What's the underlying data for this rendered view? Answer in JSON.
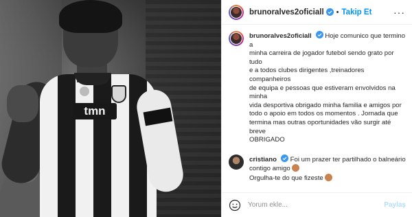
{
  "post": {
    "author": "brunoralves2oficiall",
    "follow_label": "Takip Et",
    "separator": "•",
    "more_label": "···",
    "caption_lines": [
      "Hoje comunico que termino a",
      "minha carreira de jogador futebol sendo grato por tudo",
      "e a todos clubes dirigentes ,treinadores companheiros",
      "de equipa e pessoas que estiveram envolvidos na minha",
      "vida desportiva obrigado minha familia e amigos por",
      "todo o apoio em todos os momentos . Jornada que",
      "termina mas outras oportunidades vão surgir até breve",
      "OBRIGADO"
    ],
    "photo": {
      "sponsor_text": "tmn"
    }
  },
  "comments": [
    {
      "user": "cristiano",
      "lines": [
        "Foi um prazer ter partilhado o balneário",
        "contigo amigo",
        "Orgulha-te do que fizeste"
      ]
    }
  ],
  "composer": {
    "placeholder": "Yorum ekle...",
    "share_label": "Paylaş"
  },
  "colors": {
    "link_blue": "#0095f6",
    "disabled_blue": "#b2dffc",
    "verified_blue": "#3897f0",
    "text": "#262626",
    "divider": "#efefef"
  },
  "icons": [
    "verified-badge-icon",
    "more-options-icon",
    "emoji-icon",
    "flexed-biceps-emoji-icon",
    "fist-emoji-icon"
  ]
}
